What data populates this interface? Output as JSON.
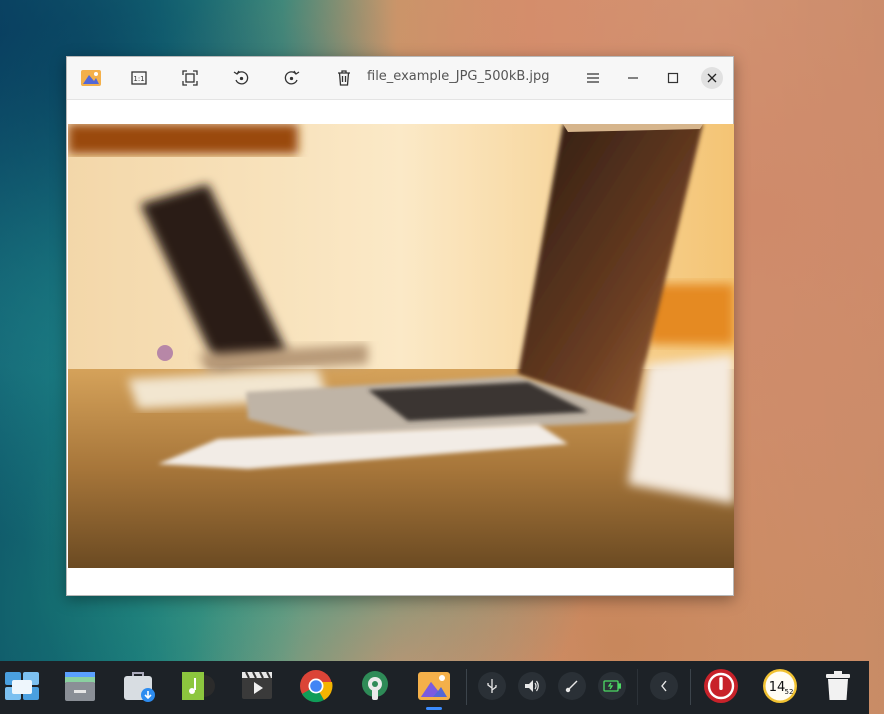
{
  "window": {
    "title": "file_example_JPG_500kB.jpg",
    "toolbar": {
      "original_size_icon": "1:1"
    }
  },
  "clock": {
    "hour": "14",
    "minute": "52"
  },
  "taskbar": {
    "apps": [
      "multitasking-view-icon",
      "file-manager-icon",
      "app-store-icon",
      "music-icon",
      "movie-icon",
      "chrome-icon",
      "control-center-icon",
      "image-viewer-icon"
    ],
    "tray": [
      "usb-icon",
      "volume-icon",
      "pen-icon",
      "battery-icon",
      "collapse-arrow-icon"
    ]
  },
  "colors": {
    "taskbar": "#1d2227",
    "window_bg": "#ffffff",
    "power_red": "#c8222a",
    "clock_yellow": "#f1c232"
  }
}
